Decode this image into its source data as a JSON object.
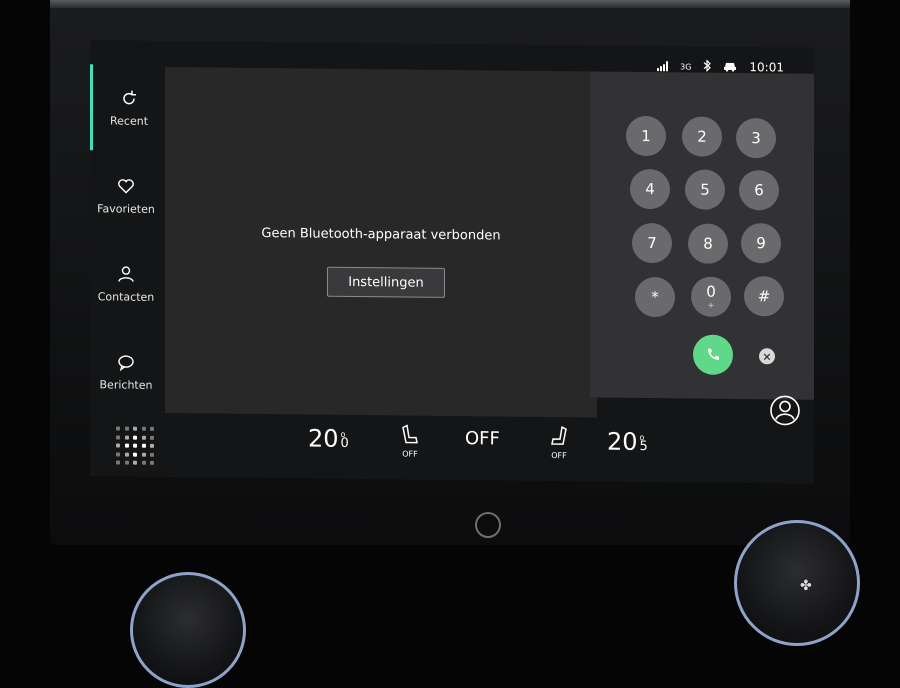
{
  "status_bar": {
    "network": "3G",
    "time": "10:01"
  },
  "sidebar": {
    "items": [
      {
        "label": "Recent",
        "icon": "refresh-icon",
        "active": true
      },
      {
        "label": "Favorieten",
        "icon": "heart-icon",
        "active": false
      },
      {
        "label": "Contacten",
        "icon": "person-icon",
        "active": false
      },
      {
        "label": "Berichten",
        "icon": "speech-bubble-icon",
        "active": false
      }
    ]
  },
  "main": {
    "message": "Geen Bluetooth-apparaat verbonden",
    "settings_label": "Instellingen"
  },
  "dialpad": {
    "keys": [
      {
        "digit": "1",
        "sub": ""
      },
      {
        "digit": "2",
        "sub": ""
      },
      {
        "digit": "3",
        "sub": ""
      },
      {
        "digit": "4",
        "sub": ""
      },
      {
        "digit": "5",
        "sub": ""
      },
      {
        "digit": "6",
        "sub": ""
      },
      {
        "digit": "7",
        "sub": ""
      },
      {
        "digit": "8",
        "sub": ""
      },
      {
        "digit": "9",
        "sub": ""
      },
      {
        "digit": "*",
        "sub": ""
      },
      {
        "digit": "0",
        "sub": "+"
      },
      {
        "digit": "#",
        "sub": ""
      }
    ],
    "call_icon": "phone-icon",
    "clear_label": "×",
    "call_color": "#5fd889"
  },
  "climate": {
    "left_temp_int": "20",
    "left_temp_dec": "0",
    "left_seat_label": "OFF",
    "fan_label": "OFF",
    "right_seat_label": "OFF",
    "right_temp_int": "20",
    "right_temp_dec": "5"
  },
  "colors": {
    "active_indicator": "#3fe0c0",
    "knob_ring": "#8fa3c8"
  }
}
